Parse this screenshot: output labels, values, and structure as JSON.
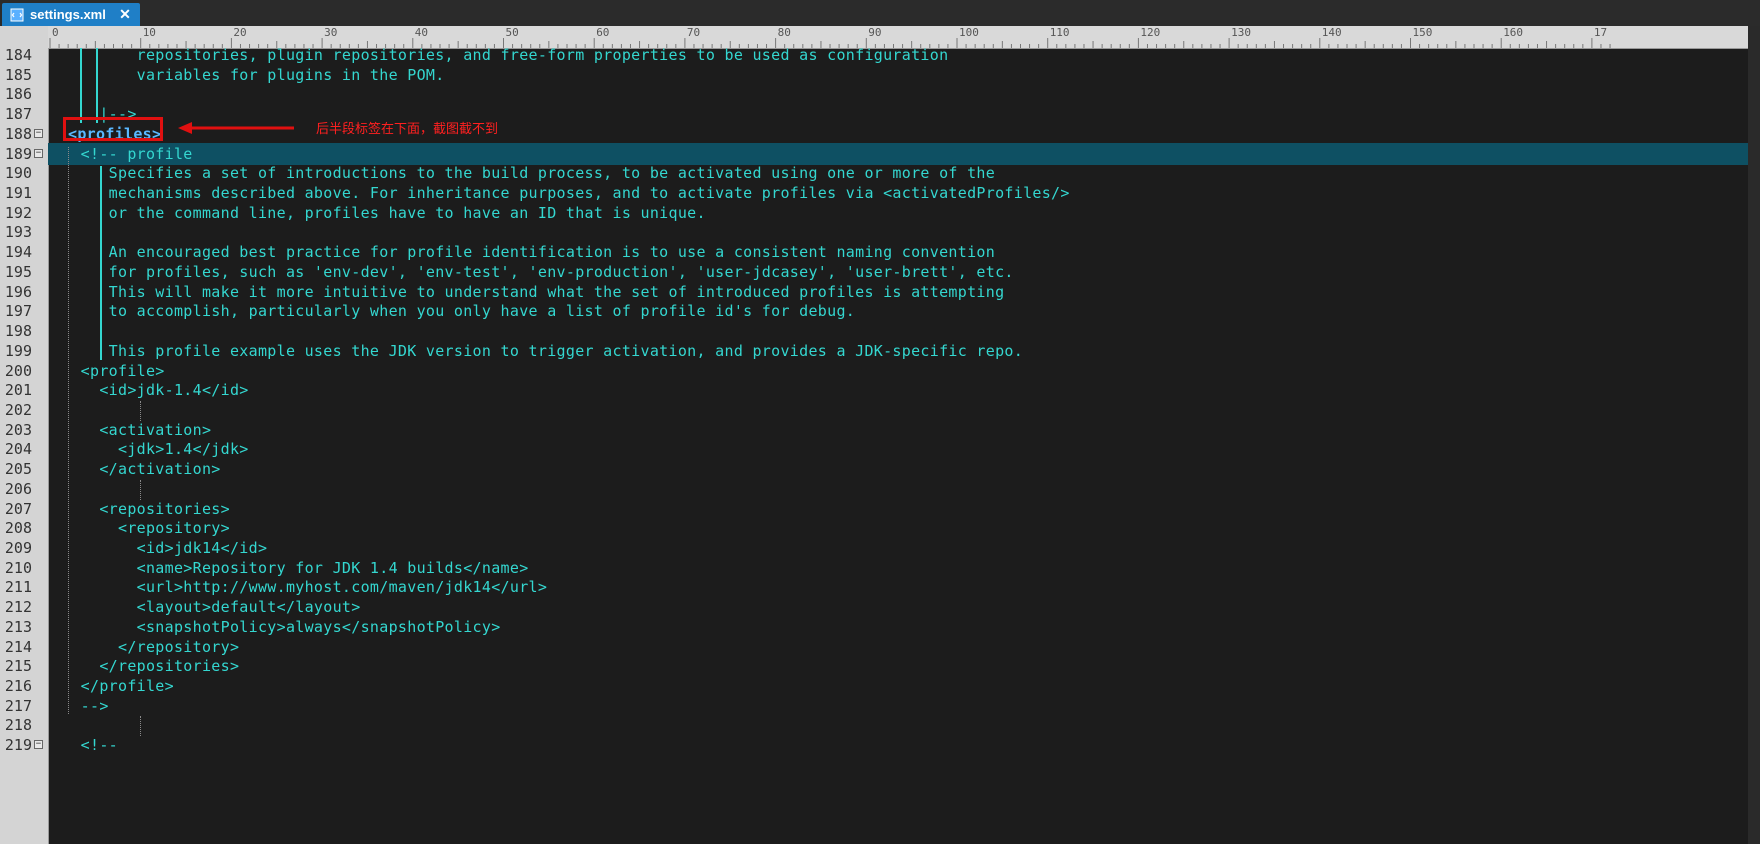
{
  "tab": {
    "title": "settings.xml",
    "close_glyph": "✕",
    "icon": "xml-file-icon"
  },
  "ruler": {
    "ticks": [
      "0",
      "10",
      "20",
      "30",
      "40",
      "50",
      "60",
      "70",
      "80",
      "90",
      "100",
      "110",
      "120",
      "130",
      "140",
      "150",
      "160",
      "17"
    ]
  },
  "lines": [
    {
      "n": "184",
      "text": "        repositories, plugin repositories, and free-form properties to be used as configuration"
    },
    {
      "n": "185",
      "text": "        variables for plugins in the POM."
    },
    {
      "n": "186",
      "text": ""
    },
    {
      "n": "187",
      "text": "    |-->"
    },
    {
      "n": "188",
      "text": "<profiles>",
      "fold": true
    },
    {
      "n": "189",
      "text": "  <!-- profile",
      "fold": true,
      "current": true
    },
    {
      "n": "190",
      "text": "     Specifies a set of introductions to the build process, to be activated using one or more of the"
    },
    {
      "n": "191",
      "text": "     mechanisms described above. For inheritance purposes, and to activate profiles via <activatedProfiles/>"
    },
    {
      "n": "192",
      "text": "     or the command line, profiles have to have an ID that is unique."
    },
    {
      "n": "193",
      "text": ""
    },
    {
      "n": "194",
      "text": "     An encouraged best practice for profile identification is to use a consistent naming convention"
    },
    {
      "n": "195",
      "text": "     for profiles, such as 'env-dev', 'env-test', 'env-production', 'user-jdcasey', 'user-brett', etc."
    },
    {
      "n": "196",
      "text": "     This will make it more intuitive to understand what the set of introduced profiles is attempting"
    },
    {
      "n": "197",
      "text": "     to accomplish, particularly when you only have a list of profile id's for debug."
    },
    {
      "n": "198",
      "text": ""
    },
    {
      "n": "199",
      "text": "     This profile example uses the JDK version to trigger activation, and provides a JDK-specific repo."
    },
    {
      "n": "200",
      "text": "  <profile>"
    },
    {
      "n": "201",
      "text": "    <id>jdk-1.4</id>"
    },
    {
      "n": "202",
      "text": ""
    },
    {
      "n": "203",
      "text": "    <activation>"
    },
    {
      "n": "204",
      "text": "      <jdk>1.4</jdk>"
    },
    {
      "n": "205",
      "text": "    </activation>"
    },
    {
      "n": "206",
      "text": ""
    },
    {
      "n": "207",
      "text": "    <repositories>"
    },
    {
      "n": "208",
      "text": "      <repository>"
    },
    {
      "n": "209",
      "text": "        <id>jdk14</id>"
    },
    {
      "n": "210",
      "text": "        <name>Repository for JDK 1.4 builds</name>"
    },
    {
      "n": "211",
      "text": "        <url>http://www.myhost.com/maven/jdk14</url>"
    },
    {
      "n": "212",
      "text": "        <layout>default</layout>"
    },
    {
      "n": "213",
      "text": "        <snapshotPolicy>always</snapshotPolicy>"
    },
    {
      "n": "214",
      "text": "      </repository>"
    },
    {
      "n": "215",
      "text": "    </repositories>"
    },
    {
      "n": "216",
      "text": "  </profile>"
    },
    {
      "n": "217",
      "text": "  -->"
    },
    {
      "n": "218",
      "text": ""
    },
    {
      "n": "219",
      "text": "  <!--",
      "fold": true
    }
  ],
  "annotation": {
    "text": "后半段标签在下面，截图截不到",
    "color": "#e01010"
  },
  "colors": {
    "code": "#34d7d0",
    "current_line": "#0e5063",
    "background": "#1c1c1c",
    "tab": "#1f7fc7"
  }
}
